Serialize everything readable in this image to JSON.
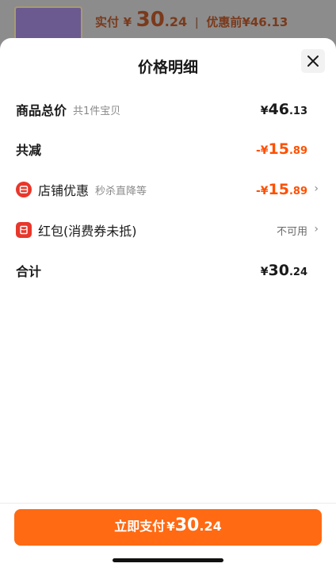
{
  "background": {
    "paid_label": "实付",
    "paid_symbol": "¥",
    "paid_int": "30",
    "paid_dec": ".24",
    "separator": "|",
    "before_label": "优惠前",
    "before_amount": "¥46.13"
  },
  "sheet": {
    "title": "价格明细"
  },
  "rows": {
    "total": {
      "label": "商品总价",
      "sub": "共1件宝贝",
      "symbol": "¥",
      "int": "46",
      "dec": ".13"
    },
    "reduction": {
      "label": "共减",
      "symbol": "-¥",
      "int": "15",
      "dec": ".89"
    },
    "store_discount": {
      "label": "店铺优惠",
      "sub": "秒杀直降等",
      "symbol": "-¥",
      "int": "15",
      "dec": ".89",
      "icon": "store-coupon-icon"
    },
    "red_packet": {
      "label": "红包(消费券未抵)",
      "status": "不可用",
      "icon": "red-packet-icon"
    },
    "sum": {
      "label": "合计",
      "symbol": "¥",
      "int": "30",
      "dec": ".24"
    }
  },
  "footer": {
    "pay_label": "立即支付",
    "pay_symbol": "¥",
    "pay_int": "30",
    "pay_dec": ".24"
  },
  "colors": {
    "accent": "#ff5000",
    "button": "#ff6a13",
    "icon_red": "#e8372b"
  }
}
